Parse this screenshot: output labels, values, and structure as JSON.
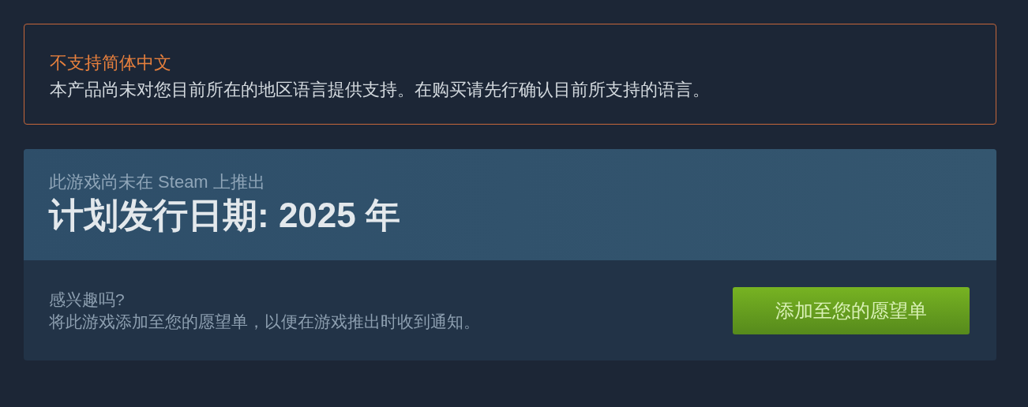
{
  "language_notice": {
    "title": "不支持简体中文",
    "message": "本产品尚未对您目前所在的地区语言提供支持。在购买请先行确认目前所支持的语言。"
  },
  "release": {
    "subtitle": "此游戏尚未在 Steam 上推出",
    "title": "计划发行日期: 2025 年",
    "question": "感兴趣吗?",
    "description": "将此游戏添加至您的愿望单，以便在游戏推出时收到通知。",
    "button": "添加至您的愿望单"
  }
}
